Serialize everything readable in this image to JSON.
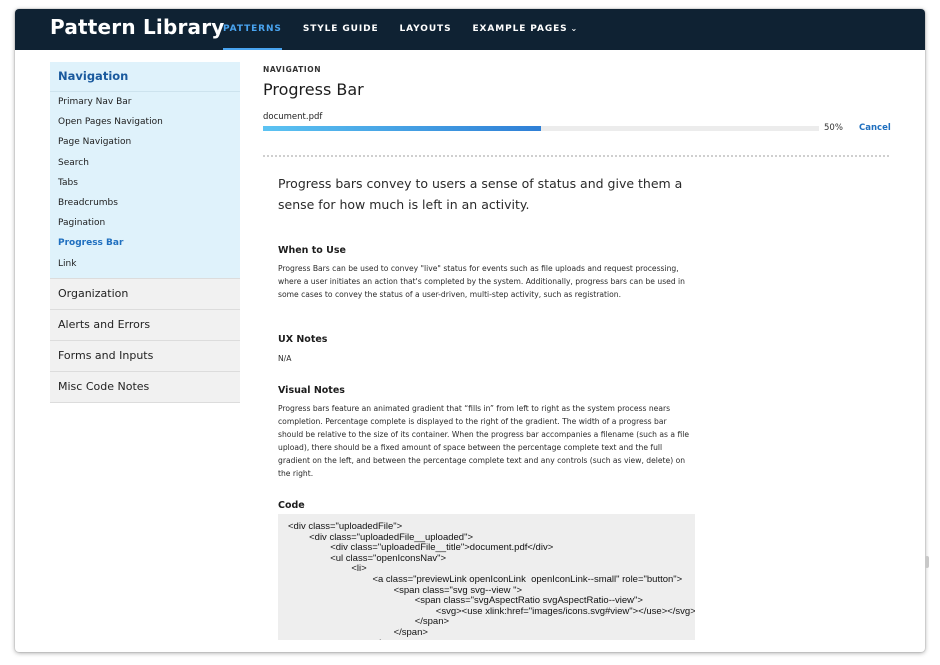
{
  "header": {
    "brand": "Pattern Library",
    "nav": [
      {
        "label": "PATTERNS",
        "active": true
      },
      {
        "label": "STYLE GUIDE"
      },
      {
        "label": "LAYOUTS"
      },
      {
        "label": "EXAMPLE PAGES",
        "caret": "⌄"
      }
    ]
  },
  "sidebar": {
    "group_title": "Navigation",
    "items": [
      "Primary Nav Bar",
      "Open Pages Navigation",
      "Page Navigation",
      "Search",
      "Tabs",
      "Breadcrumbs",
      "Pagination",
      "Progress Bar",
      "Link"
    ],
    "active_item": "Progress Bar",
    "sections": [
      "Organization",
      "Alerts and Errors",
      "Forms and Inputs",
      "Misc Code Notes"
    ]
  },
  "main": {
    "eyebrow": "NAVIGATION",
    "title": "Progress Bar",
    "demo": {
      "file_name": "document.pdf",
      "progress": 0.5,
      "percent_label": "50%",
      "cancel_label": "Cancel"
    },
    "lead": "Progress bars convey to users a sense of status and give them a sense for how much is left in an activity.",
    "when_to_use": {
      "heading": "When to Use",
      "text": "Progress Bars can be used to convey \"live\" status for events such as file uploads and request processing, where a user initiates an action that's completed by the system. Additionally, progress bars can be used in some cases to convey the status of a user-driven, multi-step activity, such as registration."
    },
    "ux_notes": {
      "heading": "UX Notes",
      "text": "N/A"
    },
    "visual_notes": {
      "heading": "Visual Notes",
      "text": "Progress bars feature an animated gradient that “fills in” from left to right as the system process nears completion. Percentage complete is displayed to the right of the gradient. The width of a progress bar should be relative to the size of its container. When the progress bar accompanies a filename (such as a file upload), there should be a fixed amount of space between the percentage complete text and the full gradient on the left, and between the percentage complete text and any controls (such as view, delete) on the right."
    },
    "code": {
      "heading": "Code",
      "snippet": "<div class=\"uploadedFile\">\n        <div class=\"uploadedFile__uploaded\">\n                <div class=\"uploadedFile__title\">document.pdf</div>\n                <ul class=\"openIconsNav\">\n                        <li>\n                                <a class=\"previewLink openIconLink  openIconLink--small\" role=\"button\">\n                                        <span class=\"svg svg--view \">\n                                                <span class=\"svgAspectRatio svgAspectRatio--view\">\n                                                        <svg><use xlink:href=\"images/icons.svg#view\"></use></svg>\n                                                </span>\n                                        </span>\n                                </a>"
    }
  },
  "colors": {
    "topbar": "#0f2233",
    "accent": "#1f6fbf",
    "nav_active": "#49a4f0",
    "progress_start": "#5cc3f2",
    "progress_end": "#2f7fd6"
  }
}
